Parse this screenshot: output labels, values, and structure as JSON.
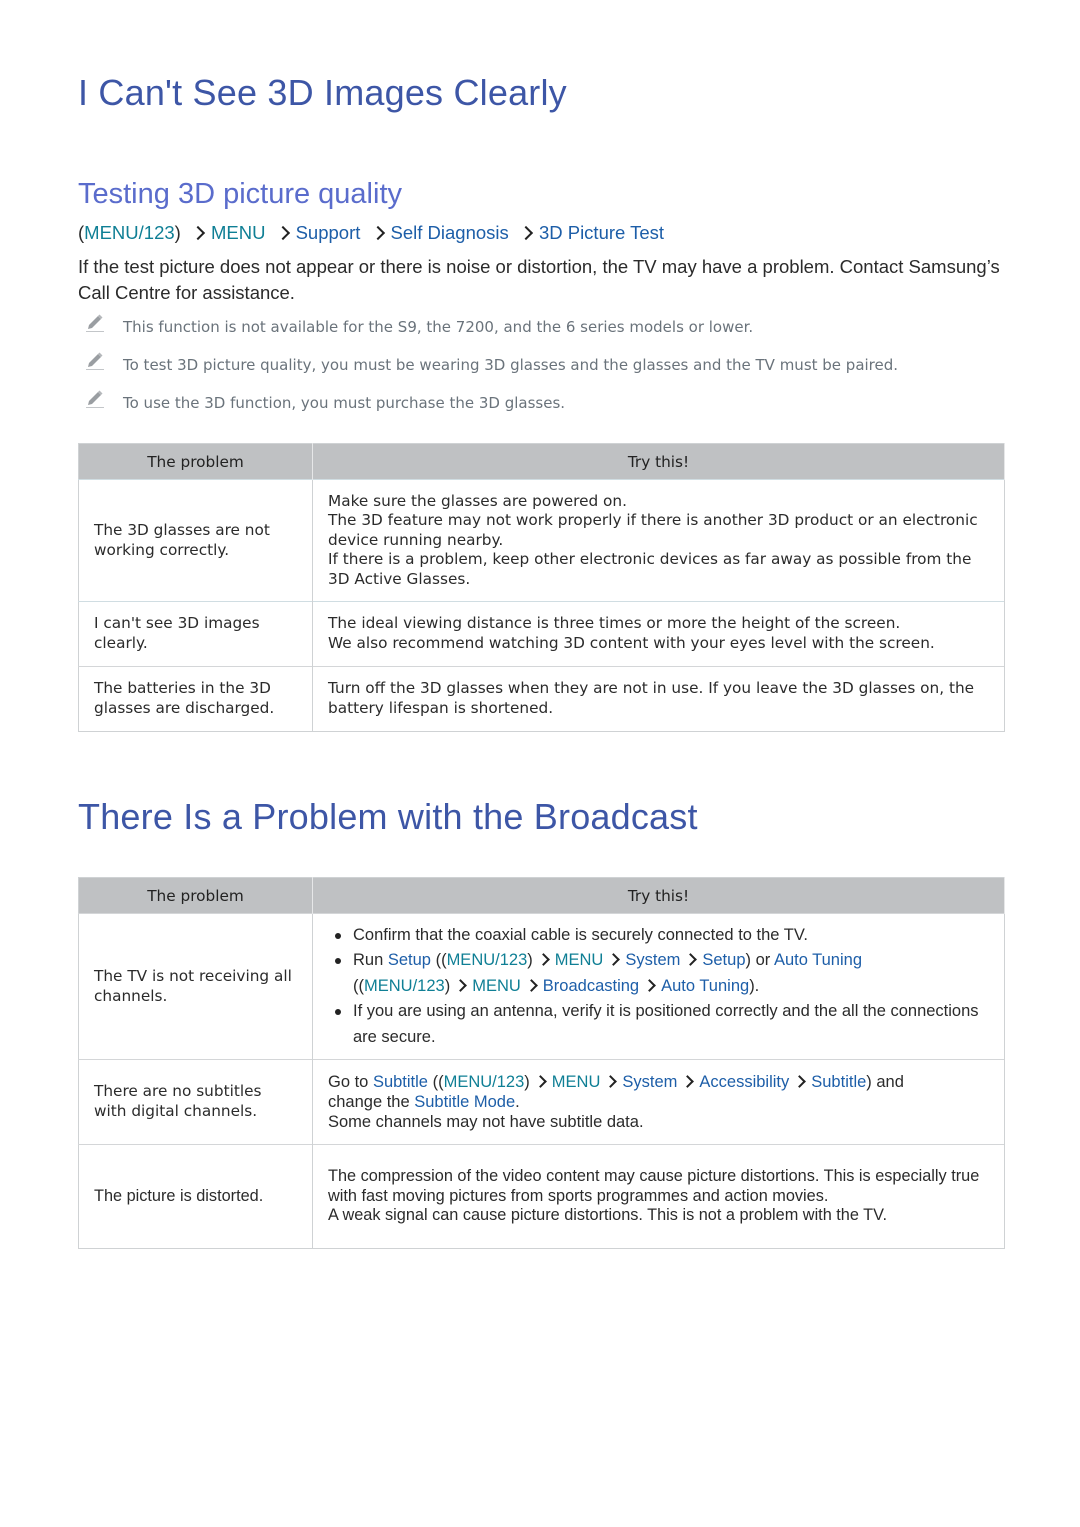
{
  "section1": {
    "title": "I Can't See 3D Images Clearly",
    "subtitle": "Testing 3D picture quality",
    "path": {
      "open": "(",
      "items": [
        "MENU/123",
        "MENU",
        "Support",
        "Self Diagnosis",
        "3D Picture Test"
      ],
      "close": ")"
    },
    "intro": "If the test picture does not appear or there is noise or distortion, the TV may have a problem. Contact Samsung’s Call Centre for assistance.",
    "notes": [
      "This function is not available for the S9, the 7200, and the 6 series models or lower.",
      "To test 3D picture quality, you must be wearing 3D glasses and the glasses and the TV must be paired.",
      "To use the 3D function, you must purchase the 3D glasses."
    ],
    "table": {
      "headers": [
        "The problem",
        "Try this!"
      ],
      "rows": [
        {
          "problem": "The 3D glasses are not working correctly.",
          "solution": [
            "Make sure the glasses are powered on.",
            "The 3D feature may not work properly if there is another 3D product or an electronic device running nearby.",
            "If there is a problem, keep other electronic devices as far away as possible from the 3D Active Glasses."
          ]
        },
        {
          "problem": "I can't see 3D images clearly.",
          "solution": [
            "The ideal viewing distance is three times or more the height of the screen.",
            "We also recommend watching 3D content with your eyes level with the screen."
          ]
        },
        {
          "problem": "The batteries in the 3D glasses are discharged.",
          "solution": [
            "Turn off the 3D glasses when they are not in use. If you leave the 3D glasses on, the battery lifespan is shortened."
          ]
        }
      ]
    }
  },
  "section2": {
    "title": "There Is a Problem with the Broadcast",
    "table": {
      "headers": [
        "The problem",
        "Try this!"
      ],
      "rows": [
        {
          "problem": "The TV is not receiving all channels.",
          "bullets": {
            "b0": "Confirm that the coaxial cable is securely connected to the TV.",
            "b1": {
              "run": "Run ",
              "setup": "Setup",
              "open": " ((",
              "menu123": "MENU/123",
              "close1": ")",
              "menu": "MENU",
              "system": "System",
              "setup2": "Setup",
              "or": ") or ",
              "auto_tuning": "Auto Tuning",
              "open2": "((",
              "menu123b": "MENU/123",
              "close2": ")",
              "menu_b": "MENU",
              "broadcasting": "Broadcasting",
              "auto_tuning2": "Auto Tuning",
              "end": ")."
            },
            "b2": "If you are using an antenna, verify it is positioned correctly and the all the connections are secure."
          }
        },
        {
          "problem": "There are no subtitles with digital channels.",
          "solution": {
            "go_to": "Go to ",
            "subtitle": "Subtitle",
            "open": " ((",
            "menu123": "MENU/123",
            "close1": ")",
            "menu": "MENU",
            "system": "System",
            "accessibility": "Accessibility",
            "subtitle2": "Subtitle",
            "and": ") and",
            "change": "change the ",
            "subtitle_mode": "Subtitle Mode",
            "period": ".",
            "line2": "Some channels may not have subtitle data."
          }
        },
        {
          "problem": "The picture is distorted.",
          "solution": [
            "The compression of the video content may cause picture distortions. This is especially true with fast moving pictures from sports programmes and action movies.",
            "A weak signal can cause picture distortions. This is not a problem with the TV."
          ]
        }
      ]
    }
  },
  "icons": {
    "note": "pencil-icon",
    "separator": "chevron-right-icon",
    "bullet": "bullet-dot"
  },
  "colors": {
    "heading": "#3d56a6",
    "subheading": "#5a6ccc",
    "menu_teal": "#0f7f95",
    "link_blue": "#1d5ea8",
    "note_gray": "#6a737b",
    "table_header": "#bfc1c3"
  }
}
